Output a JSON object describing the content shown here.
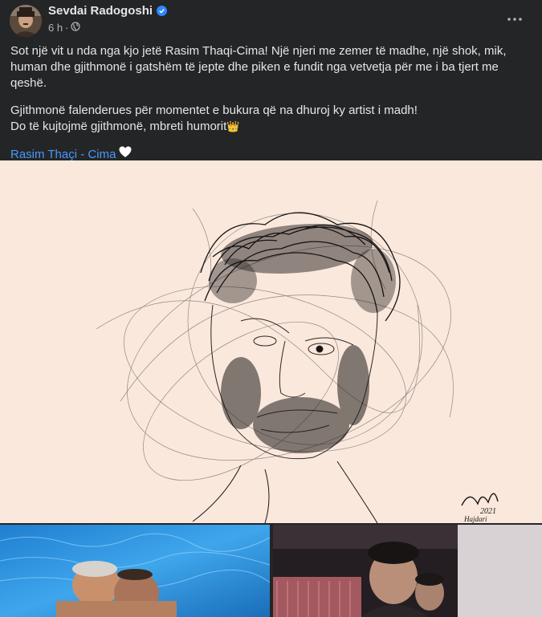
{
  "post": {
    "author": "Sevdai Radogoshi",
    "time": "6 h",
    "time_separator": "·",
    "icons": {
      "verified": "verified-badge-icon",
      "privacy": "globe-icon",
      "more": "more-options-icon"
    }
  },
  "body": {
    "paragraph1": "Sot një vit u nda nga kjo jetë Rasim Thaqi-Cima! Një njeri me zemer të madhe, një shok, mik, human dhe gjithmonë i gatshëm të jepte dhe piken e fundit nga vetvetja për me i ba tjert me qeshë.",
    "line2": "Gjithmonë falenderues për momentet e bukura që na dhuroj ky artist i madh!",
    "line3": "Do të kujtojmë gjithmonë, mbreti humorit",
    "tag": "Rasim Thaçi - Cima",
    "emoji_crown": "👑",
    "emoji_heart": "🤍"
  },
  "artwork": {
    "signature": "2021",
    "signature_name": "Hajdari"
  },
  "colors": {
    "background": "#242526",
    "text": "#e4e6eb",
    "secondary": "#b0b3b8",
    "link": "#4599ff",
    "verified": "#2d88ff",
    "artwork_bg": "#fbe8dc"
  }
}
